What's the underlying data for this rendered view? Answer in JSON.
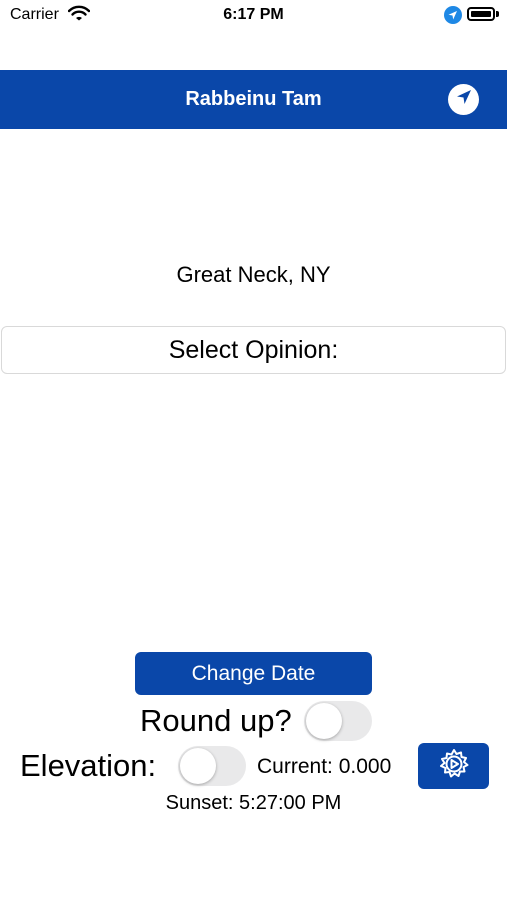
{
  "status_bar": {
    "carrier": "Carrier",
    "time": "6:17 PM"
  },
  "nav": {
    "title": "Rabbeinu Tam"
  },
  "main": {
    "city": "Great Neck, NY",
    "opinion_button_label": "Select Opinion:"
  },
  "controls": {
    "change_date_label": "Change Date",
    "round_up_label": "Round up?",
    "round_up_on": false,
    "elevation_label": "Elevation:",
    "elevation_on": false,
    "current_label": "Current: 0.000",
    "sunset_label": "Sunset: 5:27:00 PM"
  },
  "colors": {
    "accent": "#0a47a9",
    "toggle_off": "#e9e9ea",
    "location_badge": "#1e88e5"
  },
  "icons": [
    "wifi-icon",
    "location-services-icon",
    "battery-icon",
    "location-arrow-icon",
    "gear-icon"
  ]
}
